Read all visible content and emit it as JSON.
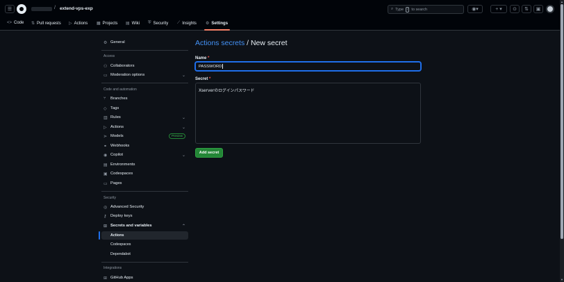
{
  "header": {
    "repo_name": "extend-vps-exp",
    "separator": "/",
    "search": {
      "prefix": "Type",
      "key": "/",
      "suffix": "to search"
    }
  },
  "tabs": [
    {
      "label": "Code",
      "icon": "code-icon"
    },
    {
      "label": "Pull requests",
      "icon": "pull-request-icon"
    },
    {
      "label": "Actions",
      "icon": "play-icon"
    },
    {
      "label": "Projects",
      "icon": "table-icon"
    },
    {
      "label": "Wiki",
      "icon": "book-icon"
    },
    {
      "label": "Security",
      "icon": "shield-icon"
    },
    {
      "label": "Insights",
      "icon": "graph-icon"
    },
    {
      "label": "Settings",
      "icon": "gear-icon"
    }
  ],
  "sidebar": {
    "general": "General",
    "sections": {
      "access": "Access",
      "code_automation": "Code and automation",
      "security": "Security",
      "integrations": "Integrations"
    },
    "items": {
      "collaborators": "Collaborators",
      "moderation": "Moderation options",
      "branches": "Branches",
      "tags": "Tags",
      "rules": "Rules",
      "actions": "Actions",
      "models": "Models",
      "models_badge": "Preview",
      "webhooks": "Webhooks",
      "copilot": "Copilot",
      "environments": "Environments",
      "codespaces": "Codespaces",
      "pages": "Pages",
      "advanced_security": "Advanced Security",
      "deploy_keys": "Deploy keys",
      "secrets_variables": "Secrets and variables",
      "sub_actions": "Actions",
      "sub_codespaces": "Codespaces",
      "sub_dependabot": "Dependabot",
      "github_apps": "GitHub Apps"
    }
  },
  "main": {
    "breadcrumb_link": "Actions secrets",
    "breadcrumb_sep": " / ",
    "title": "New secret",
    "name_label": "Name",
    "required_mark": "*",
    "name_value": "PASSWORD",
    "secret_label": "Secret",
    "secret_value": "Xserverのログインパスワード",
    "add_button": "Add secret"
  },
  "colors": {
    "accent": "#1f6feb",
    "link": "#4493f8",
    "button": "#238636",
    "active_tab": "#f78166"
  }
}
